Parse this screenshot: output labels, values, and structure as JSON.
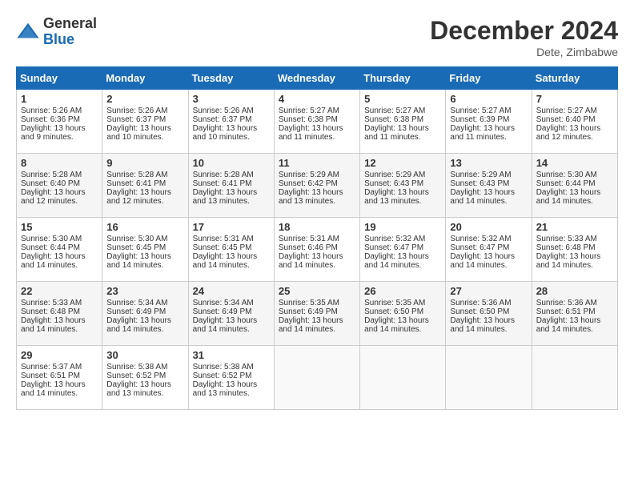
{
  "header": {
    "logo_line1": "General",
    "logo_line2": "Blue",
    "month": "December 2024",
    "location": "Dete, Zimbabwe"
  },
  "days_of_week": [
    "Sunday",
    "Monday",
    "Tuesday",
    "Wednesday",
    "Thursday",
    "Friday",
    "Saturday"
  ],
  "weeks": [
    [
      {
        "day": "1",
        "lines": [
          "Sunrise: 5:26 AM",
          "Sunset: 6:36 PM",
          "Daylight: 13 hours",
          "and 9 minutes."
        ]
      },
      {
        "day": "2",
        "lines": [
          "Sunrise: 5:26 AM",
          "Sunset: 6:37 PM",
          "Daylight: 13 hours",
          "and 10 minutes."
        ]
      },
      {
        "day": "3",
        "lines": [
          "Sunrise: 5:26 AM",
          "Sunset: 6:37 PM",
          "Daylight: 13 hours",
          "and 10 minutes."
        ]
      },
      {
        "day": "4",
        "lines": [
          "Sunrise: 5:27 AM",
          "Sunset: 6:38 PM",
          "Daylight: 13 hours",
          "and 11 minutes."
        ]
      },
      {
        "day": "5",
        "lines": [
          "Sunrise: 5:27 AM",
          "Sunset: 6:38 PM",
          "Daylight: 13 hours",
          "and 11 minutes."
        ]
      },
      {
        "day": "6",
        "lines": [
          "Sunrise: 5:27 AM",
          "Sunset: 6:39 PM",
          "Daylight: 13 hours",
          "and 11 minutes."
        ]
      },
      {
        "day": "7",
        "lines": [
          "Sunrise: 5:27 AM",
          "Sunset: 6:40 PM",
          "Daylight: 13 hours",
          "and 12 minutes."
        ]
      }
    ],
    [
      {
        "day": "8",
        "lines": [
          "Sunrise: 5:28 AM",
          "Sunset: 6:40 PM",
          "Daylight: 13 hours",
          "and 12 minutes."
        ]
      },
      {
        "day": "9",
        "lines": [
          "Sunrise: 5:28 AM",
          "Sunset: 6:41 PM",
          "Daylight: 13 hours",
          "and 12 minutes."
        ]
      },
      {
        "day": "10",
        "lines": [
          "Sunrise: 5:28 AM",
          "Sunset: 6:41 PM",
          "Daylight: 13 hours",
          "and 13 minutes."
        ]
      },
      {
        "day": "11",
        "lines": [
          "Sunrise: 5:29 AM",
          "Sunset: 6:42 PM",
          "Daylight: 13 hours",
          "and 13 minutes."
        ]
      },
      {
        "day": "12",
        "lines": [
          "Sunrise: 5:29 AM",
          "Sunset: 6:43 PM",
          "Daylight: 13 hours",
          "and 13 minutes."
        ]
      },
      {
        "day": "13",
        "lines": [
          "Sunrise: 5:29 AM",
          "Sunset: 6:43 PM",
          "Daylight: 13 hours",
          "and 14 minutes."
        ]
      },
      {
        "day": "14",
        "lines": [
          "Sunrise: 5:30 AM",
          "Sunset: 6:44 PM",
          "Daylight: 13 hours",
          "and 14 minutes."
        ]
      }
    ],
    [
      {
        "day": "15",
        "lines": [
          "Sunrise: 5:30 AM",
          "Sunset: 6:44 PM",
          "Daylight: 13 hours",
          "and 14 minutes."
        ]
      },
      {
        "day": "16",
        "lines": [
          "Sunrise: 5:30 AM",
          "Sunset: 6:45 PM",
          "Daylight: 13 hours",
          "and 14 minutes."
        ]
      },
      {
        "day": "17",
        "lines": [
          "Sunrise: 5:31 AM",
          "Sunset: 6:45 PM",
          "Daylight: 13 hours",
          "and 14 minutes."
        ]
      },
      {
        "day": "18",
        "lines": [
          "Sunrise: 5:31 AM",
          "Sunset: 6:46 PM",
          "Daylight: 13 hours",
          "and 14 minutes."
        ]
      },
      {
        "day": "19",
        "lines": [
          "Sunrise: 5:32 AM",
          "Sunset: 6:47 PM",
          "Daylight: 13 hours",
          "and 14 minutes."
        ]
      },
      {
        "day": "20",
        "lines": [
          "Sunrise: 5:32 AM",
          "Sunset: 6:47 PM",
          "Daylight: 13 hours",
          "and 14 minutes."
        ]
      },
      {
        "day": "21",
        "lines": [
          "Sunrise: 5:33 AM",
          "Sunset: 6:48 PM",
          "Daylight: 13 hours",
          "and 14 minutes."
        ]
      }
    ],
    [
      {
        "day": "22",
        "lines": [
          "Sunrise: 5:33 AM",
          "Sunset: 6:48 PM",
          "Daylight: 13 hours",
          "and 14 minutes."
        ]
      },
      {
        "day": "23",
        "lines": [
          "Sunrise: 5:34 AM",
          "Sunset: 6:49 PM",
          "Daylight: 13 hours",
          "and 14 minutes."
        ]
      },
      {
        "day": "24",
        "lines": [
          "Sunrise: 5:34 AM",
          "Sunset: 6:49 PM",
          "Daylight: 13 hours",
          "and 14 minutes."
        ]
      },
      {
        "day": "25",
        "lines": [
          "Sunrise: 5:35 AM",
          "Sunset: 6:49 PM",
          "Daylight: 13 hours",
          "and 14 minutes."
        ]
      },
      {
        "day": "26",
        "lines": [
          "Sunrise: 5:35 AM",
          "Sunset: 6:50 PM",
          "Daylight: 13 hours",
          "and 14 minutes."
        ]
      },
      {
        "day": "27",
        "lines": [
          "Sunrise: 5:36 AM",
          "Sunset: 6:50 PM",
          "Daylight: 13 hours",
          "and 14 minutes."
        ]
      },
      {
        "day": "28",
        "lines": [
          "Sunrise: 5:36 AM",
          "Sunset: 6:51 PM",
          "Daylight: 13 hours",
          "and 14 minutes."
        ]
      }
    ],
    [
      {
        "day": "29",
        "lines": [
          "Sunrise: 5:37 AM",
          "Sunset: 6:51 PM",
          "Daylight: 13 hours",
          "and 14 minutes."
        ]
      },
      {
        "day": "30",
        "lines": [
          "Sunrise: 5:38 AM",
          "Sunset: 6:52 PM",
          "Daylight: 13 hours",
          "and 13 minutes."
        ]
      },
      {
        "day": "31",
        "lines": [
          "Sunrise: 5:38 AM",
          "Sunset: 6:52 PM",
          "Daylight: 13 hours",
          "and 13 minutes."
        ]
      },
      null,
      null,
      null,
      null
    ]
  ]
}
